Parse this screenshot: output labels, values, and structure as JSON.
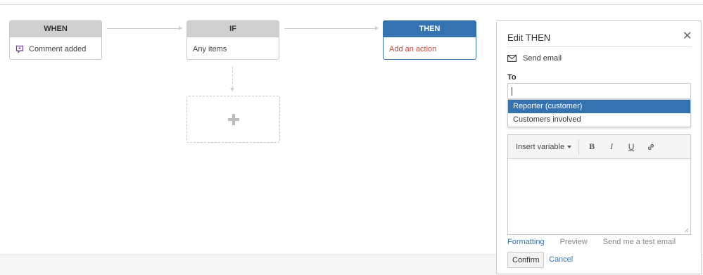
{
  "flow": {
    "when": {
      "header": "WHEN",
      "body": "Comment added",
      "icon": "comment-icon"
    },
    "if": {
      "header": "IF",
      "body": "Any items"
    },
    "then": {
      "header": "THEN",
      "body": "Add an action"
    }
  },
  "panel": {
    "title": "Edit THEN",
    "close_icon": "close-icon",
    "action": "Send email",
    "to_label": "To",
    "to_value": "",
    "dropdown": [
      "Reporter (customer)",
      "Customers involved"
    ],
    "toolbar": {
      "insert_variable": "Insert variable",
      "bold": "B",
      "italic": "I",
      "underline": "U",
      "link_icon": "link-icon"
    },
    "tabs": [
      "Formatting",
      "Preview",
      "Send me a test email"
    ],
    "confirm": "Confirm",
    "cancel": "Cancel"
  },
  "colors": {
    "accent": "#3572b0",
    "error": "#d04437",
    "header_grey": "#d0d0d0"
  }
}
